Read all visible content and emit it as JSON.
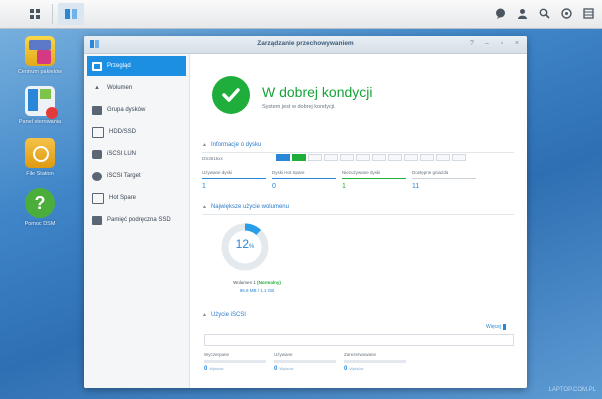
{
  "taskbar": {
    "right_icons": [
      "chat-icon",
      "user-icon",
      "search-icon",
      "options-icon",
      "widgets-icon"
    ]
  },
  "desktop": {
    "icons": [
      {
        "label": "Centrum pakietów",
        "icon": "package-center-icon"
      },
      {
        "label": "Panel sterowania",
        "icon": "control-panel-icon"
      },
      {
        "label": "File Station",
        "icon": "file-station-icon"
      },
      {
        "label": "Pomoc DSM",
        "icon": "help-icon"
      }
    ]
  },
  "window": {
    "title": "Zarządzanie przechowywaniem"
  },
  "sidebar": {
    "items": [
      {
        "label": "Przegląd",
        "icon": "overview-icon",
        "active": true
      },
      {
        "label": "Wolumen",
        "icon": "volume-icon",
        "active": false
      },
      {
        "label": "Grupa dysków",
        "icon": "disk-group-icon",
        "active": false
      },
      {
        "label": "HDD/SSD",
        "icon": "hdd-icon",
        "active": false
      },
      {
        "label": "iSCSI LUN",
        "icon": "iscsi-lun-icon",
        "active": false
      },
      {
        "label": "iSCSI Target",
        "icon": "iscsi-target-icon",
        "active": false
      },
      {
        "label": "Hot Spare",
        "icon": "hot-spare-icon",
        "active": false
      },
      {
        "label": "Pamięć podręczna SSD",
        "icon": "ssd-cache-icon",
        "active": false
      }
    ]
  },
  "status": {
    "title": "W dobrej kondycji",
    "subtitle": "System jest w dobrej kondycji."
  },
  "disk_info": {
    "heading": "Informacje o dysku",
    "unit_label": "DS3615xs",
    "slots_total": 12,
    "slots_used": 2,
    "stats": [
      {
        "label": "Używane dyski",
        "value": "1",
        "color": "#2a86d6"
      },
      {
        "label": "Dyski Hot Spare",
        "value": "0",
        "color": "#2a86d6"
      },
      {
        "label": "Niezużywane dyski",
        "value": "1",
        "color": "#1fae3b"
      },
      {
        "label": "Dostępne gniazda",
        "value": "11",
        "color": "#9aa6b2"
      }
    ]
  },
  "volume_usage": {
    "heading": "Największe użycie wolumenu",
    "percent": 12,
    "percent_value": "12",
    "percent_unit": "%",
    "name_prefix": "Wolumen 1",
    "name_status": "(Normalny)",
    "size": "96.6 MB / 1.1 GB"
  },
  "iscsi_usage": {
    "heading": "Użycie iSCSI",
    "link": "Więcej",
    "stats": [
      {
        "label": "Wyczerpane",
        "value": "0",
        "unit": "Wpisów"
      },
      {
        "label": "Używane",
        "value": "0",
        "unit": "Wpisów"
      },
      {
        "label": "Zarezerwowane",
        "value": "0",
        "unit": "Wpisów"
      }
    ]
  },
  "watermark": "LAPTOP.COM.PL",
  "colors": {
    "accent": "#1d8fe3",
    "healthy": "#1fae3b"
  }
}
